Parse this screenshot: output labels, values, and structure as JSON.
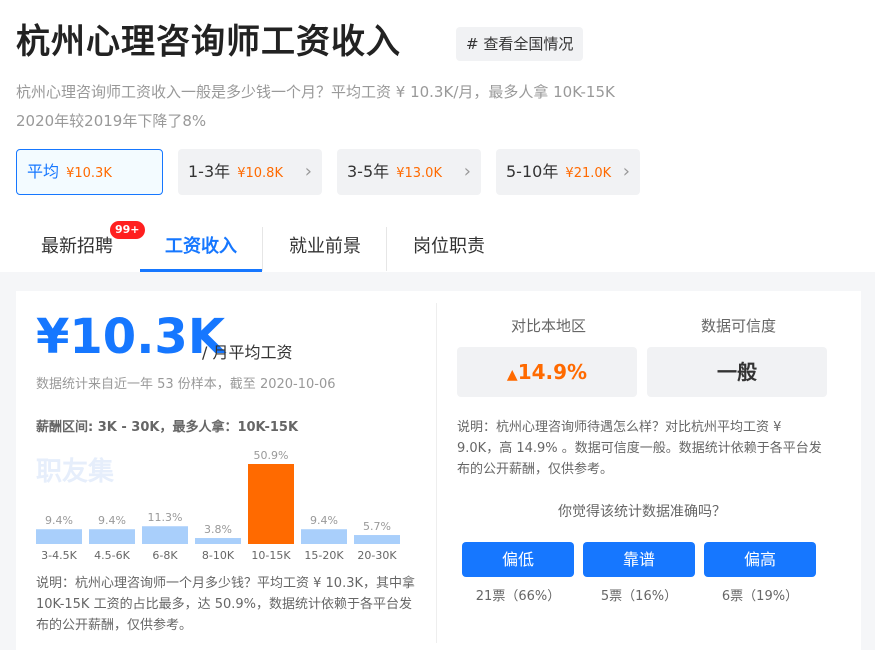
{
  "header": {
    "title": "杭州心理咨询师工资收入",
    "tag": "# 查看全国情况",
    "subtitle_line1": "杭州心理咨询师工资收入一般是多少钱一个月？平均工资 ¥ 10.3K/月，最多人拿 10K-15K",
    "subtitle_line2": "2020年较2019年下降了8%"
  },
  "filters": [
    {
      "label": "平均",
      "value": "¥10.3K"
    },
    {
      "label": "1-3年",
      "value": "¥10.8K"
    },
    {
      "label": "3-5年",
      "value": "¥13.0K"
    },
    {
      "label": "5-10年",
      "value": "¥21.0K"
    }
  ],
  "tabs": [
    {
      "label": "最新招聘",
      "badge": "99+"
    },
    {
      "label": "工资收入"
    },
    {
      "label": "就业前景"
    },
    {
      "label": "岗位职责"
    }
  ],
  "salary": {
    "amount": "¥10.3K",
    "unit": "/ 月平均工资",
    "stat_note": "数据统计来自近一年 53 份样本，截至 2020-10-06",
    "range": "薪酬区间: 3K - 30K，最多人拿：10K-15K",
    "watermark": "职友集",
    "note": "说明：杭州心理咨询师一个月多少钱？平均工资 ¥ 10.3K，其中拿 10K-15K 工资的占比最多，达 50.9%，数据统计依赖于各平台发布的公开薪酬，仅供参考。"
  },
  "chart_data": {
    "type": "bar",
    "categories": [
      "3-4.5K",
      "4.5-6K",
      "6-8K",
      "8-10K",
      "10-15K",
      "15-20K",
      "20-30K"
    ],
    "values": [
      9.4,
      9.4,
      11.3,
      3.8,
      50.9,
      9.4,
      5.7
    ],
    "value_labels": [
      "9.4%",
      "9.4%",
      "11.3%",
      "3.8%",
      "50.9%",
      "9.4%",
      "5.7%"
    ],
    "highlight_index": 4,
    "colors": {
      "normal": "#a9cffb",
      "highlight": "#ff6a00"
    }
  },
  "compare": {
    "label": "对比本地区",
    "value": "14.9%",
    "arrow_icon": "arrow-up-icon",
    "trust_label": "数据可信度",
    "trust_value": "一般",
    "note": "说明：杭州心理咨询师待遇怎么样？对比杭州平均工资 ¥ 9.0K，高 14.9% 。数据可信度一般。数据统计依赖于各平台发布的公开薪酬，仅供参考。"
  },
  "survey": {
    "question": "你觉得该统计数据准确吗？",
    "options": [
      {
        "label": "偏低",
        "count": "21票（66%）"
      },
      {
        "label": "靠谱",
        "count": "5票（16%）"
      },
      {
        "label": "偏高",
        "count": "6票（19%）"
      }
    ]
  },
  "colors": {
    "accent": "#1677ff",
    "highlight": "#ff6a00"
  }
}
